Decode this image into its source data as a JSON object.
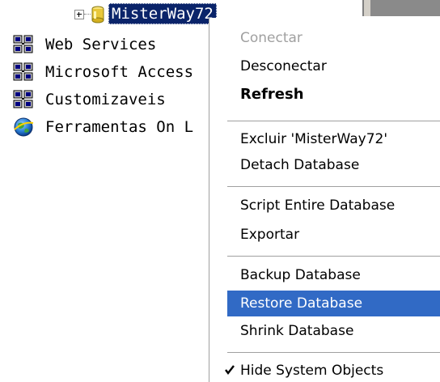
{
  "tree": {
    "items": [
      {
        "label": "MisterWay72",
        "icon": "database-icon",
        "selected": true
      },
      {
        "label": "Web Services",
        "icon": "server-group-icon"
      },
      {
        "label": "Microsoft Access",
        "icon": "server-group-icon"
      },
      {
        "label": "Customizaveis",
        "icon": "server-group-icon"
      },
      {
        "label": "Ferramentas On L",
        "icon": "globe-icon"
      }
    ]
  },
  "context_menu": {
    "items": [
      {
        "label": "Conectar",
        "state": "disabled"
      },
      {
        "label": "Desconectar"
      },
      {
        "label": "Refresh",
        "style": "bold"
      },
      {
        "label": "Excluir 'MisterWay72'"
      },
      {
        "label": "Detach Database"
      },
      {
        "label": "Script Entire Database"
      },
      {
        "label": "Exportar"
      },
      {
        "label": "Backup Database"
      },
      {
        "label": "Restore Database",
        "state": "highlighted"
      },
      {
        "label": "Shrink Database"
      },
      {
        "label": "Hide System Objects",
        "checked": true
      }
    ],
    "highlight_color": "#316ac5"
  },
  "colors": {
    "selection_bg": "#0a246a",
    "disabled_text": "#a0a0a0"
  }
}
